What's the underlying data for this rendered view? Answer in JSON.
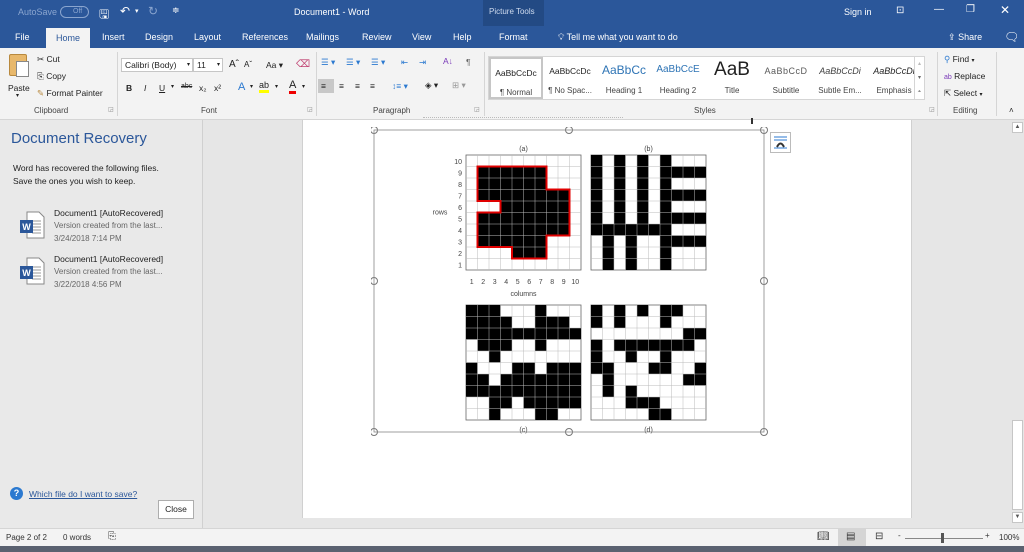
{
  "titlebar": {
    "autosave_label": "AutoSave",
    "autosave_state": "Off",
    "doc_title": "Document1  -  Word",
    "context_group": "Picture Tools",
    "sign_in": "Sign in"
  },
  "tabs": [
    {
      "label": "File"
    },
    {
      "label": "Home"
    },
    {
      "label": "Insert"
    },
    {
      "label": "Design"
    },
    {
      "label": "Layout"
    },
    {
      "label": "References"
    },
    {
      "label": "Mailings"
    },
    {
      "label": "Review"
    },
    {
      "label": "View"
    },
    {
      "label": "Help"
    },
    {
      "label": "Format"
    }
  ],
  "tell_me": "Tell me what you want to do",
  "share": "Share",
  "clipboard": {
    "paste": "Paste",
    "cut": "Cut",
    "copy": "Copy",
    "format_painter": "Format Painter",
    "group": "Clipboard"
  },
  "font": {
    "name": "Calibri (Body)",
    "size": "11",
    "group": "Font",
    "case": "Aa"
  },
  "paragraph": {
    "group": "Paragraph"
  },
  "styles": {
    "group": "Styles",
    "items": [
      {
        "sample": "AaBbCcDc",
        "name": "¶ Normal"
      },
      {
        "sample": "AaBbCcDc",
        "name": "¶ No Spac..."
      },
      {
        "sample": "AaBbCc",
        "name": "Heading 1"
      },
      {
        "sample": "AaBbCcE",
        "name": "Heading 2"
      },
      {
        "sample": "AaB",
        "name": "Title"
      },
      {
        "sample": "AaBbCcD",
        "name": "Subtitle"
      },
      {
        "sample": "AaBbCcDi",
        "name": "Subtle Em..."
      },
      {
        "sample": "AaBbCcDi",
        "name": "Emphasis"
      }
    ]
  },
  "editing": {
    "find": "Find",
    "replace": "Replace",
    "select": "Select",
    "group": "Editing"
  },
  "recovery": {
    "title": "Document Recovery",
    "line1": "Word has recovered the following files.",
    "line2": "Save the ones you wish to keep.",
    "files": [
      {
        "name": "Document1  [AutoRecovered]",
        "desc": "Version created from the last...",
        "date": "3/24/2018 7:14 PM"
      },
      {
        "name": "Document1  [AutoRecovered]",
        "desc": "Version created from the last...",
        "date": "3/22/2018 4:56 PM"
      }
    ],
    "help_link": "Which file do I want to save?",
    "close": "Close"
  },
  "figure": {
    "panels": [
      {
        "label": "(a)",
        "ylabel": "rows",
        "xlabel": "columns",
        "outlined": true,
        "filled_rows": [
          [],
          [
            2,
            3,
            4,
            5,
            6,
            7
          ],
          [
            2,
            3,
            4,
            5,
            6,
            7
          ],
          [
            2,
            3,
            4,
            5,
            6,
            7,
            8,
            9
          ],
          [
            4,
            5,
            6,
            7,
            8,
            9
          ],
          [
            2,
            3,
            4,
            5,
            6,
            7,
            8,
            9
          ],
          [
            2,
            3,
            4,
            5,
            6,
            7,
            8,
            9
          ],
          [
            2,
            3,
            4,
            5,
            6,
            7
          ],
          [
            5,
            6,
            7
          ],
          []
        ],
        "row_ticks": [
          "10",
          "9",
          "8",
          "7",
          "6",
          "5",
          "4",
          "3",
          "2",
          "1"
        ],
        "col_ticks": [
          "1",
          "2",
          "3",
          "4",
          "5",
          "6",
          "7",
          "8",
          "9",
          "10"
        ]
      },
      {
        "label": "(b)",
        "filled_rows": [
          [
            1,
            3,
            5,
            7
          ],
          [
            1,
            3,
            5,
            7,
            8,
            9,
            10
          ],
          [
            1,
            3,
            5,
            7
          ],
          [
            1,
            3,
            5,
            7,
            8,
            9,
            10
          ],
          [
            1,
            3,
            5,
            7
          ],
          [
            1,
            3,
            5,
            7,
            8,
            9,
            10
          ],
          [
            1,
            2,
            3,
            4,
            5,
            6,
            7
          ],
          [
            2,
            4,
            7,
            8,
            9,
            10
          ],
          [
            2,
            4,
            7
          ],
          [
            2,
            4,
            7
          ]
        ]
      },
      {
        "label": "(c)",
        "filled_rows": [
          [
            1,
            2,
            3,
            7
          ],
          [
            1,
            2,
            3,
            4,
            7,
            8,
            9
          ],
          [
            1,
            2,
            3,
            4,
            5,
            6,
            7,
            8,
            9,
            10
          ],
          [
            2,
            3,
            4,
            7
          ],
          [
            3
          ],
          [
            1,
            5,
            6,
            8,
            9,
            10
          ],
          [
            1,
            2,
            4,
            5,
            6,
            7,
            8,
            9,
            10
          ],
          [
            1,
            2,
            3,
            4,
            5,
            6,
            7,
            8,
            9,
            10
          ],
          [
            3,
            4,
            6,
            7,
            8,
            9,
            10
          ],
          [
            3,
            7,
            8
          ]
        ]
      },
      {
        "label": "(d)",
        "filled_rows": [
          [
            1,
            3,
            5,
            7,
            8
          ],
          [
            1,
            3,
            7
          ],
          [
            9,
            10
          ],
          [
            1,
            3,
            4,
            5,
            6,
            7,
            8,
            9
          ],
          [
            1,
            4,
            7
          ],
          [
            1,
            2,
            6,
            7,
            10
          ],
          [
            2,
            9,
            10
          ],
          [
            2,
            4
          ],
          [
            4,
            5,
            6
          ],
          [
            6,
            7
          ]
        ]
      }
    ]
  },
  "status": {
    "page": "Page 2 of 2",
    "words": "0 words",
    "zoom": "100%",
    "zoom_minus": "-",
    "zoom_plus": "+"
  },
  "colors": {
    "brand": "#2b579a",
    "outline": "#e00000"
  }
}
